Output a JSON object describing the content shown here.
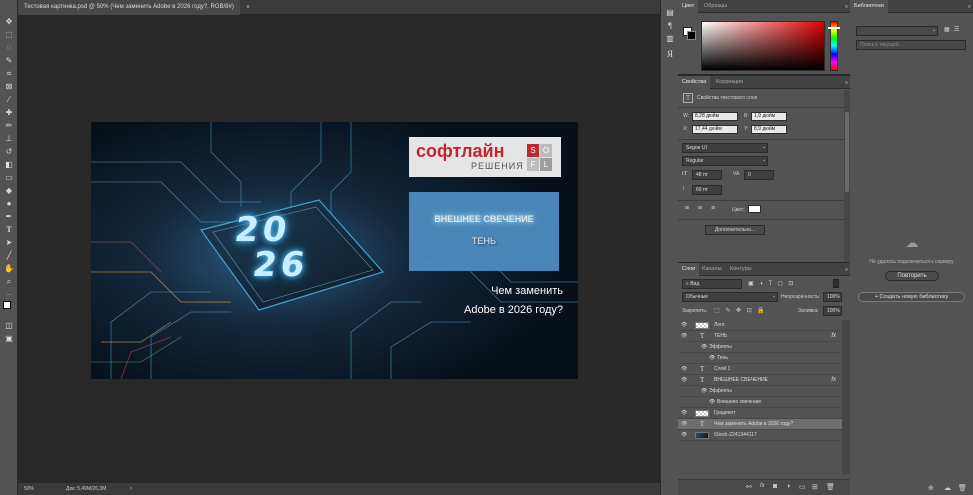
{
  "document": {
    "tab_title": "Тестовая картинка.psd @ 50% (Чем заменить Adobe в 2026 году?, RGB/8#)",
    "close_glyph": "×"
  },
  "status": {
    "zoom": "50%",
    "doc_info": "Док: 5,49M/26,3M"
  },
  "artwork": {
    "logo_text": "софтлайн",
    "logo_sub": "РЕШЕНИЯ",
    "logo_letters": [
      "S",
      "O",
      "F",
      "L"
    ],
    "year_top": "20",
    "year_bottom": "26",
    "effect_title": "ВНЕШНЕЕ СВЕЧЕНИЕ",
    "effect_sub": "ТЕНЬ",
    "headline_1": "Чем заменить",
    "headline_2": "Adobe в 2026 году?"
  },
  "color_panel": {
    "tabs": [
      "Цвет",
      "Образцы"
    ]
  },
  "properties": {
    "tabs": [
      "Свойства",
      "Коррекция"
    ],
    "subtitle": "Свойства текстового слоя",
    "w_label": "W:",
    "w_value": "8,28 дюйм",
    "h_label": "В:",
    "h_value": "1,9 дюйм",
    "x_label": "X:",
    "x_value": "17,44 дюйм",
    "y_label": "Y:",
    "y_value": "8,9 дюйм",
    "font_family": "Segoe UI",
    "font_style": "Regular",
    "font_size": "48 пт",
    "tracking_label": "VA",
    "tracking": "0",
    "leading": "60 пт",
    "color_label": "Цвет:",
    "more_button": "Дополнительно..."
  },
  "layers_panel": {
    "tabs": [
      "Слои",
      "Каналы",
      "Контуры"
    ],
    "filter": "Вид",
    "blend_mode": "Обычные",
    "opacity_label": "Непрозрачность:",
    "opacity": "100%",
    "lock_label": "Закрепить:",
    "fill_label": "Заливка:",
    "fill": "100%",
    "fx_glyph": "fx",
    "items": [
      {
        "name": "Лого",
        "kind": "raster",
        "indent": 0,
        "selected": false,
        "fx": false
      },
      {
        "name": "ТЕНЬ",
        "kind": "text",
        "indent": 0,
        "selected": false,
        "fx": true
      },
      {
        "name": "Эффекты",
        "kind": "effects",
        "indent": 1,
        "selected": false,
        "fx": false
      },
      {
        "name": "Тень",
        "kind": "effect",
        "indent": 2,
        "selected": false,
        "fx": false
      },
      {
        "name": "Слой 1",
        "kind": "text",
        "indent": 0,
        "selected": false,
        "fx": false
      },
      {
        "name": "ВНЕШНЕЕ СВЕЧЕНИЕ",
        "kind": "text",
        "indent": 0,
        "selected": false,
        "fx": true
      },
      {
        "name": "Эффекты",
        "kind": "effects",
        "indent": 1,
        "selected": false,
        "fx": false
      },
      {
        "name": "Внешнее свечение",
        "kind": "effect",
        "indent": 2,
        "selected": false,
        "fx": false
      },
      {
        "name": "Градиент",
        "kind": "raster",
        "indent": 0,
        "selected": false,
        "fx": false
      },
      {
        "name": "Чем заменить Adobe в 2026 году?",
        "kind": "text",
        "indent": 0,
        "selected": true,
        "fx": false
      },
      {
        "name": "iStock-2241344117",
        "kind": "image",
        "indent": 0,
        "selected": false,
        "fx": false
      }
    ]
  },
  "libraries_panel": {
    "title": "Библиотеки",
    "search_placeholder": "Поиск в текущей...",
    "offline_message": "Не удалось подключиться к серверу",
    "retry_button": "Повторить",
    "create_button": "+ Создать новую библиотеку"
  },
  "colors": {
    "panel_bg": "#535353",
    "workspace_bg": "#282828",
    "selected_layer": "#6d6d6d",
    "logo_red": "#c0272d",
    "effect_box": "#4f8fc4",
    "glow": "#8ed8ff"
  }
}
